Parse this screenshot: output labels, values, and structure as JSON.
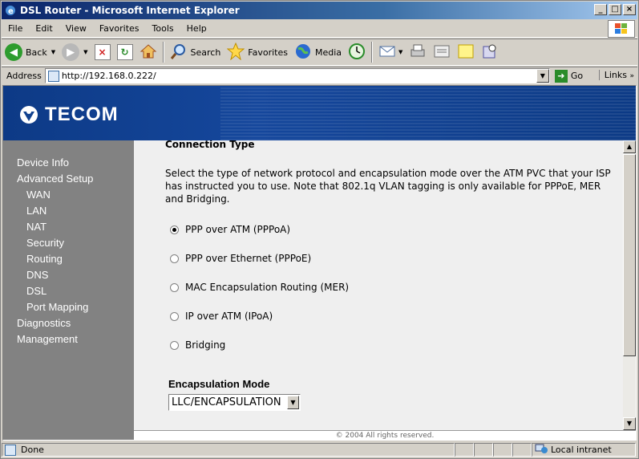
{
  "window": {
    "title": "DSL Router - Microsoft Internet Explorer"
  },
  "menu": [
    "File",
    "Edit",
    "View",
    "Favorites",
    "Tools",
    "Help"
  ],
  "toolbar": {
    "back": "Back",
    "search": "Search",
    "favorites": "Favorites",
    "media": "Media"
  },
  "address": {
    "label": "Address",
    "url": "http://192.168.0.222/",
    "go": "Go",
    "links": "Links"
  },
  "brand": {
    "name": "TECOM"
  },
  "sidebar": {
    "items": [
      "Device Info",
      "Advanced Setup",
      "WAN",
      "LAN",
      "NAT",
      "Security",
      "Routing",
      "DNS",
      "DSL",
      "Port Mapping",
      "Diagnostics",
      "Management"
    ]
  },
  "content": {
    "heading": "Connection Type",
    "description": "Select the type of network protocol and encapsulation mode over the ATM PVC that your ISP has instructed you to use. Note that 802.1q VLAN tagging is only available for PPPoE, MER and Bridging.",
    "options": [
      {
        "label": "PPP over ATM (PPPoA)",
        "selected": true
      },
      {
        "label": "PPP over Ethernet (PPPoE)",
        "selected": false
      },
      {
        "label": "MAC Encapsulation Routing (MER)",
        "selected": false
      },
      {
        "label": "IP over ATM (IPoA)",
        "selected": false
      },
      {
        "label": "Bridging",
        "selected": false
      }
    ],
    "encapsulation_label": "Encapsulation Mode",
    "encapsulation_value": "LLC/ENCAPSULATION"
  },
  "footer": "© 2004 All rights reserved.",
  "status": {
    "text": "Done",
    "zone": "Local intranet"
  }
}
